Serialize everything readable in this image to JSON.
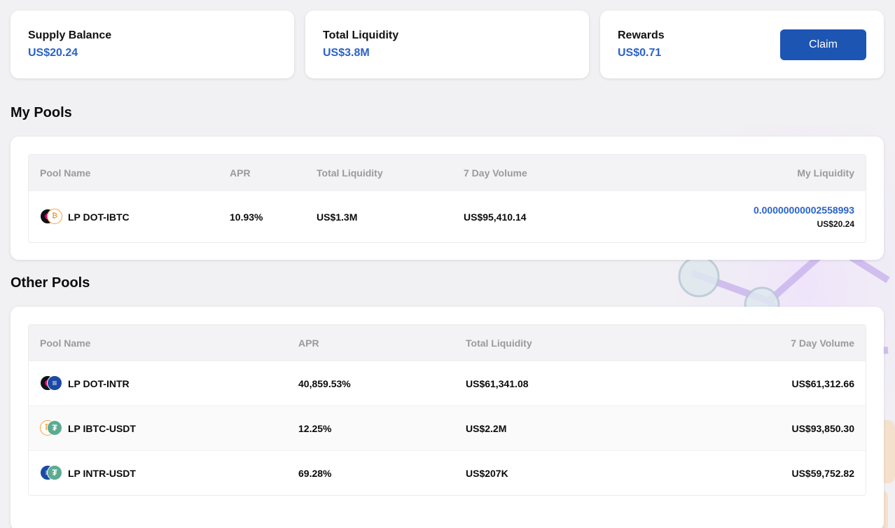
{
  "stats": {
    "supply_balance": {
      "label": "Supply Balance",
      "value": "US$20.24"
    },
    "total_liquidity": {
      "label": "Total Liquidity",
      "value": "US$3.8M"
    },
    "rewards": {
      "label": "Rewards",
      "value": "US$0.71",
      "claim_label": "Claim"
    }
  },
  "my_pools": {
    "title": "My Pools",
    "columns": [
      "Pool Name",
      "APR",
      "Total Liquidity",
      "7 Day Volume",
      "My Liquidity"
    ],
    "rows": [
      {
        "name": "LP DOT-IBTC",
        "icons": [
          "dot-icon",
          "ibtc-icon"
        ],
        "apr": "10.93%",
        "total_liquidity": "US$1.3M",
        "volume_7d": "US$95,410.14",
        "my_liquidity": "0.00000000002558993",
        "my_liquidity_usd": "US$20.24"
      }
    ]
  },
  "other_pools": {
    "title": "Other Pools",
    "columns": [
      "Pool Name",
      "APR",
      "Total Liquidity",
      "7 Day Volume"
    ],
    "rows": [
      {
        "name": "LP DOT-INTR",
        "icons": [
          "dot-icon",
          "intr-icon"
        ],
        "apr": "40,859.53%",
        "total_liquidity": "US$61,341.08",
        "volume_7d": "US$61,312.66"
      },
      {
        "name": "LP IBTC-USDT",
        "icons": [
          "ibtc-icon",
          "usdt-icon"
        ],
        "apr": "12.25%",
        "total_liquidity": "US$2.2M",
        "volume_7d": "US$93,850.30"
      },
      {
        "name": "LP INTR-USDT",
        "icons": [
          "intr-icon",
          "usdt-icon"
        ],
        "apr": "69.28%",
        "total_liquidity": "US$207K",
        "volume_7d": "US$59,752.82"
      }
    ]
  },
  "colors": {
    "accent": "#2a62c9",
    "button": "#1d55b3",
    "background": "#f1f1f3"
  }
}
